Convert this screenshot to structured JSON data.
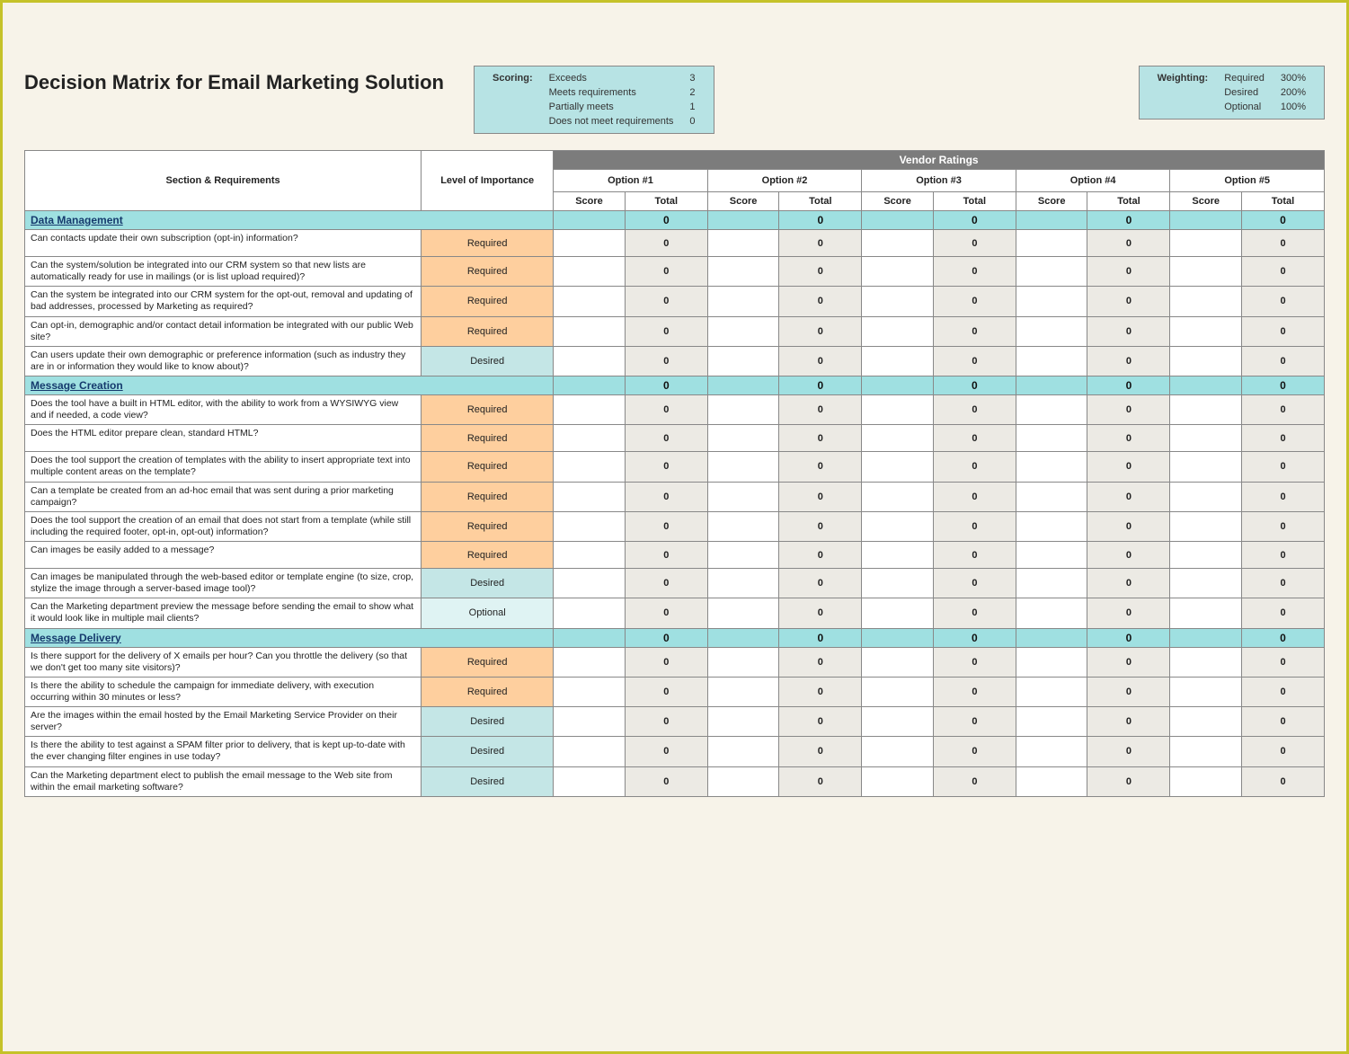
{
  "title": "Decision Matrix for Email Marketing Solution",
  "scoring": {
    "label": "Scoring:",
    "rows": [
      {
        "desc": "Exceeds",
        "val": "3"
      },
      {
        "desc": "Meets requirements",
        "val": "2"
      },
      {
        "desc": "Partially meets",
        "val": "1"
      },
      {
        "desc": "Does not meet requirements",
        "val": "0"
      }
    ]
  },
  "weighting": {
    "label": "Weighting:",
    "rows": [
      {
        "desc": "Required",
        "val": "300%"
      },
      {
        "desc": "Desired",
        "val": "200%"
      },
      {
        "desc": "Optional",
        "val": "100%"
      }
    ]
  },
  "headers": {
    "section": "Section & Requirements",
    "loi": "Level of Importance",
    "vendor": "Vendor Ratings",
    "options": [
      "Option #1",
      "Option #2",
      "Option #3",
      "Option #4",
      "Option #5"
    ],
    "score": "Score",
    "total": "Total"
  },
  "sections": [
    {
      "name": "Data Management",
      "totals": [
        "0",
        "0",
        "0",
        "0",
        "0"
      ],
      "rows": [
        {
          "q": "Can contacts update their own subscription (opt-in) information?",
          "loi": "Required",
          "t": "0"
        },
        {
          "q": "Can the system/solution be integrated into our CRM system so that new lists are automatically ready for use in mailings (or is list upload required)?",
          "loi": "Required",
          "t": "0"
        },
        {
          "q": "Can the system be integrated into our CRM system for the opt-out, removal and updating of bad addresses, processed by Marketing as required?",
          "loi": "Required",
          "t": "0"
        },
        {
          "q": "Can opt-in, demographic and/or contact detail information be integrated with our public Web site?",
          "loi": "Required",
          "t": "0"
        },
        {
          "q": "Can users update their own demographic or preference information (such as industry they are in or information they would like to know about)?",
          "loi": "Desired",
          "t": "0"
        }
      ]
    },
    {
      "name": "Message Creation",
      "totals": [
        "0",
        "0",
        "0",
        "0",
        "0"
      ],
      "rows": [
        {
          "q": "Does the tool have a built in HTML editor, with the ability to work from a WYSIWYG view and if needed, a code view?",
          "loi": "Required",
          "t": "0"
        },
        {
          "q": "Does the HTML editor prepare clean, standard HTML?",
          "loi": "Required",
          "t": "0"
        },
        {
          "q": "Does the tool support the creation of templates with the ability to insert appropriate text into multiple content areas on the template?",
          "loi": "Required",
          "t": "0"
        },
        {
          "q": "Can a template be created from an ad-hoc email that was sent during a prior marketing campaign?",
          "loi": "Required",
          "t": "0"
        },
        {
          "q": "Does the tool support the creation of an email that does not start from a template (while still including the required footer, opt-in, opt-out) information?",
          "loi": "Required",
          "t": "0"
        },
        {
          "q": "Can images be easily added to a message?",
          "loi": "Required",
          "t": "0"
        },
        {
          "q": "Can images be manipulated through the web-based editor or template engine (to size, crop, stylize the image through a server-based image tool)?",
          "loi": "Desired",
          "t": "0"
        },
        {
          "q": "Can the Marketing department preview the message before sending the email to show what it would look like in multiple mail clients?",
          "loi": "Optional",
          "t": "0"
        }
      ]
    },
    {
      "name": "Message Delivery",
      "totals": [
        "0",
        "0",
        "0",
        "0",
        "0"
      ],
      "rows": [
        {
          "q": "Is there support for the delivery of X emails per hour?  Can you throttle the delivery (so that we don't get too many site visitors)?",
          "loi": "Required",
          "t": "0"
        },
        {
          "q": "Is there the ability to schedule the campaign for immediate delivery, with execution occurring within 30 minutes or less?",
          "loi": "Required",
          "t": "0"
        },
        {
          "q": "Are the images within the email hosted by the Email Marketing Service Provider on their server?",
          "loi": "Desired",
          "t": "0"
        },
        {
          "q": "Is there the ability to test against a SPAM filter prior to delivery, that is kept up-to-date with the ever changing filter engines in use today?",
          "loi": "Desired",
          "t": "0"
        },
        {
          "q": "Can the Marketing department elect to publish the email message to the Web site from within the email marketing software?",
          "loi": "Desired",
          "t": "0"
        }
      ]
    }
  ]
}
